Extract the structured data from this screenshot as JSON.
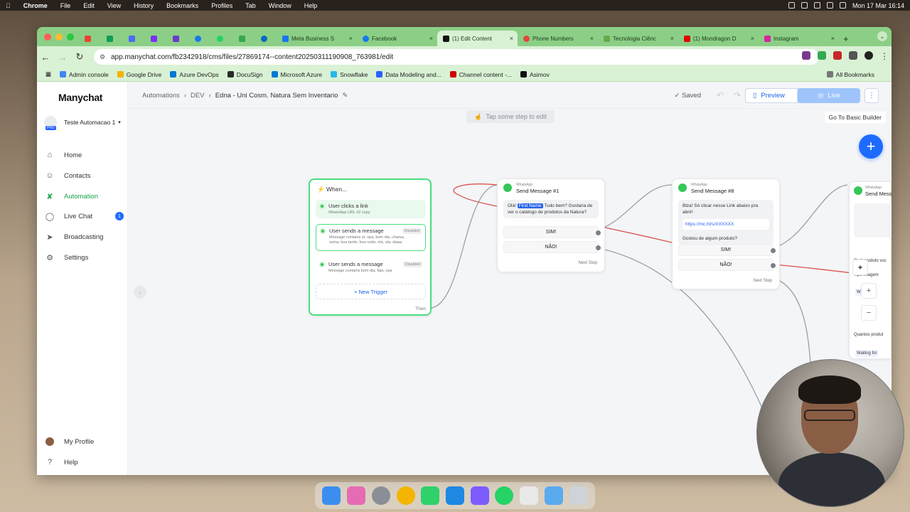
{
  "menubar": {
    "app": "Chrome",
    "items": [
      "File",
      "Edit",
      "View",
      "History",
      "Bookmarks",
      "Profiles",
      "Tab",
      "Window",
      "Help"
    ],
    "clock": "Mon 17 Mar  16:14"
  },
  "browser": {
    "tabs": [
      {
        "label": "Meta Business S",
        "color": "#1877f2"
      },
      {
        "label": "Facebook",
        "color": "#1877f2"
      },
      {
        "label": "(1) Edit Content",
        "color": "#111111",
        "active": true
      },
      {
        "label": "Phone Numbers",
        "color": "#e0483a"
      },
      {
        "label": "Tecnologia Ciênc",
        "color": "#6aa84f"
      },
      {
        "label": "(1) Mondragon D",
        "color": "#e00000"
      },
      {
        "label": "Instagram",
        "color": "#d6249f"
      }
    ],
    "url": "app.manychat.com/fb2342918/cms/files/27869174--content20250311190908_763981/edit",
    "bookmarks": [
      {
        "label": "Admin console",
        "color": "#4285f4"
      },
      {
        "label": "Google Drive",
        "color": "#f4b400"
      },
      {
        "label": "Azure DevOps",
        "color": "#0078d4"
      },
      {
        "label": "DocuSign",
        "color": "#2b2b2b"
      },
      {
        "label": "Microsoft Azure",
        "color": "#0078d4"
      },
      {
        "label": "Snowflake",
        "color": "#29b5e8"
      },
      {
        "label": "Data Modeling and...",
        "color": "#2962ff"
      },
      {
        "label": "Channel content -...",
        "color": "#cc0000"
      },
      {
        "label": "Asimov",
        "color": "#111111"
      }
    ],
    "all_bookmarks": "All Bookmarks"
  },
  "app": {
    "logo": "Manychat",
    "account": "Teste Automacao 1",
    "account_badge": "PRO",
    "nav": [
      {
        "label": "Home"
      },
      {
        "label": "Contacts"
      },
      {
        "label": "Automation"
      },
      {
        "label": "Live Chat",
        "badge": "1"
      },
      {
        "label": "Broadcasting"
      },
      {
        "label": "Settings"
      }
    ],
    "bottom_nav": [
      {
        "label": "My Profile"
      },
      {
        "label": "Help"
      }
    ],
    "breadcrumb": [
      "Automations",
      "DEV",
      "Edna - Uni Cosm. Natura Sem Inventario"
    ],
    "saved": "Saved",
    "preview": "Preview",
    "live": "Live",
    "basic_builder": "Go To Basic Builder",
    "hint": "Tap some step to edit"
  },
  "flow": {
    "trigger": {
      "title": "When...",
      "rows": [
        {
          "title": "User clicks a link",
          "sub": "WhatsApp URL #2 copy",
          "status": ""
        },
        {
          "title": "User sends a message",
          "sub": "Message contains oi, opa, bom dia, chama, ssma, boa tarde, boa noite, olá, ola, olaaa",
          "status": "Disabled"
        },
        {
          "title": "User sends a message",
          "sub": "Message contains bom dia, fala, opa",
          "status": "Disabled"
        }
      ],
      "new_trigger": "+ New Trigger",
      "then": "Then"
    },
    "msg1": {
      "kind": "WhatsApp",
      "title": "Send Message #1",
      "greeting": "Olá!",
      "name_tag": "First Name",
      "body_rest": "Tudo bem? Gostaria de ver o catálogo de produtos da Natura?",
      "buttons": [
        "SIM!",
        "NÃO!"
      ],
      "next": "Next Step"
    },
    "msg8": {
      "kind": "WhatsApp",
      "title": "Send Message #8",
      "intro": "Blza! Só clicar nesse Link abaixo pra abrir!",
      "link": "https://mc.ht/s/XXXXXX",
      "question": "Gostou de algum produto?",
      "buttons": [
        "SIM!",
        "NÃO!"
      ],
      "next": "Next Step"
    },
    "msg_partial": {
      "kind": "WhatsApp",
      "title": "Send Messa",
      "lines": [
        "Qual produto voc",
        "Tipo Imagem",
        "Waiting fo",
        "Quantos produt",
        "Waiting for"
      ]
    }
  }
}
